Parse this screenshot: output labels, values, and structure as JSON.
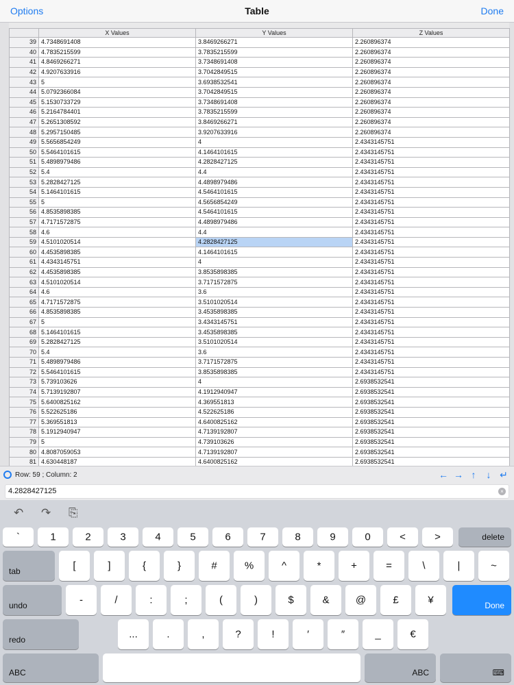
{
  "nav": {
    "left": "Options",
    "title": "Table",
    "right": "Done"
  },
  "grid": {
    "headers": [
      "",
      "X Values",
      "Y Values",
      "Z Values"
    ],
    "selected": {
      "row": 59,
      "col": 2
    },
    "rows": [
      [
        "39",
        "4.7348691408",
        "3.8469266271",
        "2.260896374"
      ],
      [
        "40",
        "4.7835215599",
        "3.7835215599",
        "2.260896374"
      ],
      [
        "41",
        "4.8469266271",
        "3.7348691408",
        "2.260896374"
      ],
      [
        "42",
        "4.9207633916",
        "3.7042849515",
        "2.260896374"
      ],
      [
        "43",
        "5",
        "3.6938532541",
        "2.260896374"
      ],
      [
        "44",
        "5.0792366084",
        "3.7042849515",
        "2.260896374"
      ],
      [
        "45",
        "5.1530733729",
        "3.7348691408",
        "2.260896374"
      ],
      [
        "46",
        "5.2164784401",
        "3.7835215599",
        "2.260896374"
      ],
      [
        "47",
        "5.2651308592",
        "3.8469266271",
        "2.260896374"
      ],
      [
        "48",
        "5.2957150485",
        "3.9207633916",
        "2.260896374"
      ],
      [
        "49",
        "5.5656854249",
        "4",
        "2.4343145751"
      ],
      [
        "50",
        "5.5464101615",
        "4.1464101615",
        "2.4343145751"
      ],
      [
        "51",
        "5.4898979486",
        "4.2828427125",
        "2.4343145751"
      ],
      [
        "52",
        "5.4",
        "4.4",
        "2.4343145751"
      ],
      [
        "53",
        "5.2828427125",
        "4.4898979486",
        "2.4343145751"
      ],
      [
        "54",
        "5.1464101615",
        "4.5464101615",
        "2.4343145751"
      ],
      [
        "55",
        "5",
        "4.5656854249",
        "2.4343145751"
      ],
      [
        "56",
        "4.8535898385",
        "4.5464101615",
        "2.4343145751"
      ],
      [
        "57",
        "4.7171572875",
        "4.4898979486",
        "2.4343145751"
      ],
      [
        "58",
        "4.6",
        "4.4",
        "2.4343145751"
      ],
      [
        "59",
        "4.5101020514",
        "4.2828427125",
        "2.4343145751"
      ],
      [
        "60",
        "4.4535898385",
        "4.1464101615",
        "2.4343145751"
      ],
      [
        "61",
        "4.4343145751",
        "4",
        "2.4343145751"
      ],
      [
        "62",
        "4.4535898385",
        "3.8535898385",
        "2.4343145751"
      ],
      [
        "63",
        "4.5101020514",
        "3.7171572875",
        "2.4343145751"
      ],
      [
        "64",
        "4.6",
        "3.6",
        "2.4343145751"
      ],
      [
        "65",
        "4.7171572875",
        "3.5101020514",
        "2.4343145751"
      ],
      [
        "66",
        "4.8535898385",
        "3.4535898385",
        "2.4343145751"
      ],
      [
        "67",
        "5",
        "3.4343145751",
        "2.4343145751"
      ],
      [
        "68",
        "5.1464101615",
        "3.4535898385",
        "2.4343145751"
      ],
      [
        "69",
        "5.2828427125",
        "3.5101020514",
        "2.4343145751"
      ],
      [
        "70",
        "5.4",
        "3.6",
        "2.4343145751"
      ],
      [
        "71",
        "5.4898979486",
        "3.7171572875",
        "2.4343145751"
      ],
      [
        "72",
        "5.5464101615",
        "3.8535898385",
        "2.4343145751"
      ],
      [
        "73",
        "5.739103626",
        "4",
        "2.6938532541"
      ],
      [
        "74",
        "5.7139192807",
        "4.1912940947",
        "2.6938532541"
      ],
      [
        "75",
        "5.6400825162",
        "4.369551813",
        "2.6938532541"
      ],
      [
        "76",
        "5.522625186",
        "4.522625186",
        "2.6938532541"
      ],
      [
        "77",
        "5.369551813",
        "4.6400825162",
        "2.6938532541"
      ],
      [
        "78",
        "5.1912940947",
        "4.7139192807",
        "2.6938532541"
      ],
      [
        "79",
        "5",
        "4.739103626",
        "2.6938532541"
      ],
      [
        "80",
        "4.8087059053",
        "4.7139192807",
        "2.6938532541"
      ],
      [
        "81",
        "4.630448187",
        "4.6400825162",
        "2.6938532541"
      ]
    ]
  },
  "status": {
    "text": "Row: 59 ; Column: 2",
    "icon": "refresh-icon",
    "arrows": [
      "←",
      "→",
      "↑",
      "↓",
      "↵"
    ]
  },
  "editor": {
    "value": "4.2828427125",
    "clear": "×"
  },
  "toolbar": {
    "undo": "↶",
    "redo": "↷",
    "paste": "⎘"
  },
  "keyboard": {
    "row1": [
      "`",
      "1",
      "2",
      "3",
      "4",
      "5",
      "6",
      "7",
      "8",
      "9",
      "0",
      "<",
      ">"
    ],
    "delete": "delete",
    "tab": "tab",
    "row2": [
      "[",
      "]",
      "{",
      "}",
      "#",
      "%",
      "^",
      "*",
      "+",
      "=",
      "\\",
      "|",
      "~"
    ],
    "undo": "undo",
    "row3": [
      "-",
      "/",
      ":",
      ";",
      "(",
      ")",
      "$",
      "&",
      "@",
      "£",
      "¥"
    ],
    "done": "Done",
    "redo": "redo",
    "row4": [
      "...",
      ".",
      ",",
      "?",
      "!",
      "′",
      "″",
      "_",
      "€"
    ],
    "abc_left": "ABC",
    "abc_right": "ABC",
    "hide": "⌨"
  },
  "colors": {
    "accent": "#1f7cf0",
    "selected_cell": "#b9d4f5",
    "done_key": "#1f8bff"
  }
}
